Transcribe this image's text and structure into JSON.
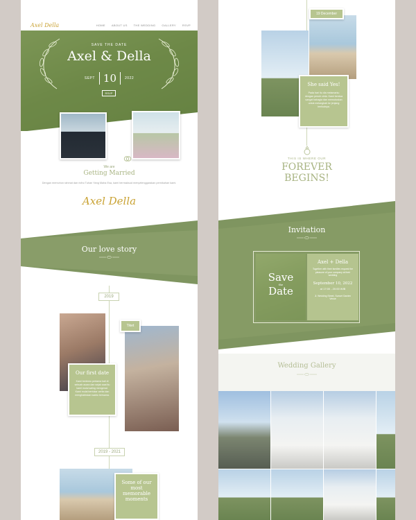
{
  "left": {
    "nav": {
      "logo": "Axel Della",
      "items": [
        "HOME",
        "ABOUT US",
        "THE WEDDING",
        "GALLERY",
        "RSVP"
      ]
    },
    "hero": {
      "kicker": "SAVE THE DATE",
      "names": "Axel & Della",
      "month": "SEPT",
      "day": "10",
      "year": "2022",
      "button": "RSVP"
    },
    "married": {
      "kicker": "We are",
      "title": "Getting Married",
      "body": "Dengan memohon rahmat dan ridho Tuhan Yang Maha Esa, kami bermaksud menyelenggarakan pernikahan kami.",
      "signature": "Axel Della"
    },
    "love_story": {
      "title": "Our love story",
      "year1": "2019",
      "tag1": "Tiket",
      "card1_title": "Our first date",
      "card1_body": "Kami bertemu pertama kali di sebuah acara dan sejak saat itu kami mulai saling mengenal. Kami mulai bertukar cerita dan menghabiskan waktu bersama.",
      "year2": "2019 - 2021",
      "card2_title": "Some of our most memorable moments"
    }
  },
  "right": {
    "date_tag": "19 December",
    "said_yes_title": "She said Yes!",
    "said_yes_body": "Pada hari itu dia melamarku dengan penuh cinta. Kami berdua sangat bahagia dan memutuskan untuk melangkah ke jenjang berikutnya.",
    "forever_kicker": "THIS IS WHERE OUR",
    "forever_line1": "FOREVER",
    "forever_line2": "BEGINS!",
    "invitation": {
      "title": "Invitation",
      "save": "Save",
      "the": "the",
      "date": "Date",
      "names": "Axel + Della",
      "intro": "Together with their families request the pleasure of your company at their wedding",
      "when": "September 10, 2022",
      "time": "at 17:00 - 20:00 WIB",
      "venue": "Jl. Wedding Street, Sunset Garden Venue"
    },
    "gallery": {
      "title": "Wedding Gallery"
    }
  },
  "colors": {
    "accent": "#8da26a",
    "card": "#b7c590",
    "gold": "#c9a233",
    "background": "#d2cbc6"
  }
}
